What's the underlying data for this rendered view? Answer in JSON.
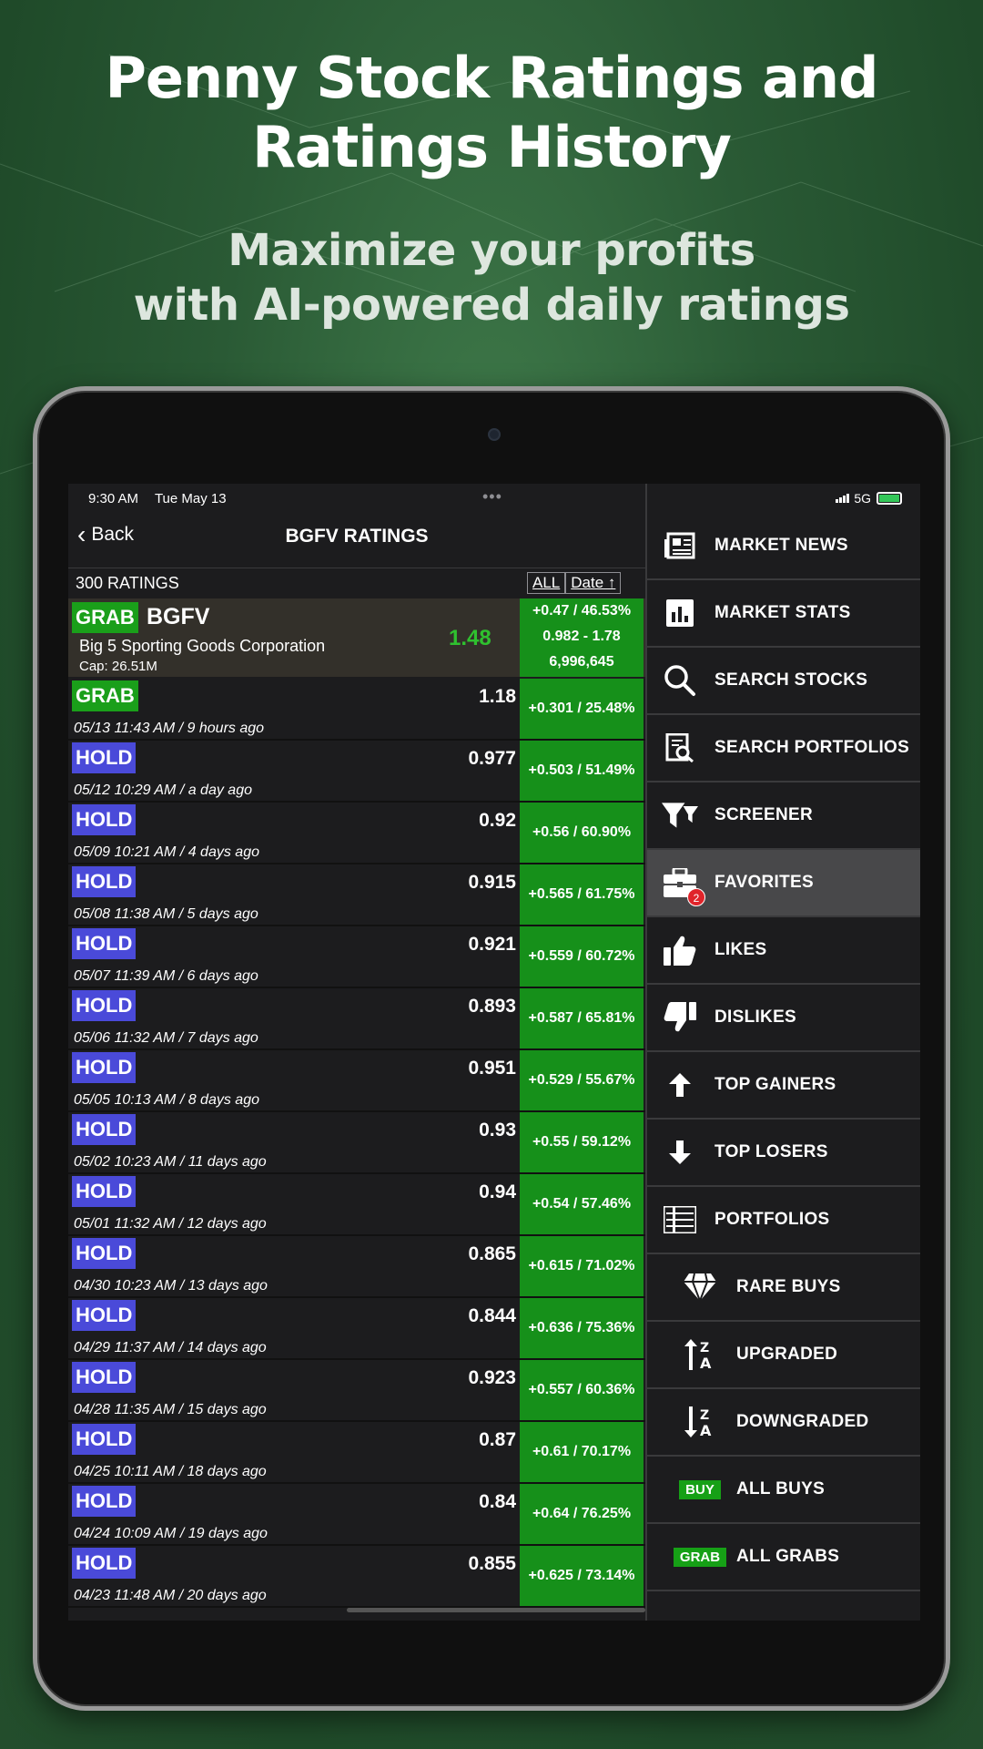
{
  "promo": {
    "headline_line1": "Penny Stock Ratings and",
    "headline_line2": "Ratings History",
    "subhead_line1": "Maximize your profits",
    "subhead_line2": "with AI-powered daily ratings"
  },
  "status": {
    "time": "9:30 AM",
    "date": "Tue May 13",
    "network": "5G"
  },
  "nav": {
    "back_label": "Back",
    "title": "BGFV RATINGS"
  },
  "list_header": {
    "count": "300 RATINGS",
    "filter_all": "ALL",
    "sort_label": "Date ↑"
  },
  "stock": {
    "rating": "GRAB",
    "ticker": "BGFV",
    "name": "Big 5 Sporting Goods Corporation",
    "cap": "Cap: 26.51M",
    "price": "1.48",
    "change": "+0.47 / 46.53%",
    "range": "0.982 - 1.78",
    "volume": "6,996,645"
  },
  "ratings": [
    {
      "rating": "GRAB",
      "price": "1.18",
      "date": "05/13 11:43 AM / 9 hours ago",
      "change": "+0.301 / 25.48%"
    },
    {
      "rating": "HOLD",
      "price": "0.977",
      "date": "05/12 10:29 AM / a day ago",
      "change": "+0.503 / 51.49%"
    },
    {
      "rating": "HOLD",
      "price": "0.92",
      "date": "05/09 10:21 AM / 4 days ago",
      "change": "+0.56 / 60.90%"
    },
    {
      "rating": "HOLD",
      "price": "0.915",
      "date": "05/08 11:38 AM / 5 days ago",
      "change": "+0.565 / 61.75%"
    },
    {
      "rating": "HOLD",
      "price": "0.921",
      "date": "05/07 11:39 AM / 6 days ago",
      "change": "+0.559 / 60.72%"
    },
    {
      "rating": "HOLD",
      "price": "0.893",
      "date": "05/06 11:32 AM / 7 days ago",
      "change": "+0.587 / 65.81%"
    },
    {
      "rating": "HOLD",
      "price": "0.951",
      "date": "05/05 10:13 AM / 8 days ago",
      "change": "+0.529 / 55.67%"
    },
    {
      "rating": "HOLD",
      "price": "0.93",
      "date": "05/02 10:23 AM / 11 days ago",
      "change": "+0.55 / 59.12%"
    },
    {
      "rating": "HOLD",
      "price": "0.94",
      "date": "05/01 11:32 AM / 12 days ago",
      "change": "+0.54 / 57.46%"
    },
    {
      "rating": "HOLD",
      "price": "0.865",
      "date": "04/30 10:23 AM / 13 days ago",
      "change": "+0.615 / 71.02%"
    },
    {
      "rating": "HOLD",
      "price": "0.844",
      "date": "04/29 11:37 AM / 14 days ago",
      "change": "+0.636 / 75.36%"
    },
    {
      "rating": "HOLD",
      "price": "0.923",
      "date": "04/28 11:35 AM / 15 days ago",
      "change": "+0.557 / 60.36%"
    },
    {
      "rating": "HOLD",
      "price": "0.87",
      "date": "04/25 10:11 AM / 18 days ago",
      "change": "+0.61 / 70.17%"
    },
    {
      "rating": "HOLD",
      "price": "0.84",
      "date": "04/24 10:09 AM / 19 days ago",
      "change": "+0.64 / 76.25%"
    },
    {
      "rating": "HOLD",
      "price": "0.855",
      "date": "04/23 11:48 AM / 20 days ago",
      "change": "+0.625 / 73.14%"
    }
  ],
  "menu": [
    {
      "label": "MARKET NEWS",
      "icon": "newspaper-icon"
    },
    {
      "label": "MARKET STATS",
      "icon": "bar-chart-icon"
    },
    {
      "label": "SEARCH STOCKS",
      "icon": "search-icon"
    },
    {
      "label": "SEARCH PORTFOLIOS",
      "icon": "search-document-icon"
    },
    {
      "label": "SCREENER",
      "icon": "filter-icon"
    },
    {
      "label": "FAVORITES",
      "icon": "briefcase-icon",
      "active": true,
      "notification": "2"
    },
    {
      "label": "LIKES",
      "icon": "thumbs-up-icon"
    },
    {
      "label": "DISLIKES",
      "icon": "thumbs-down-icon"
    },
    {
      "label": "TOP GAINERS",
      "icon": "arrow-up-icon"
    },
    {
      "label": "TOP LOSERS",
      "icon": "arrow-down-icon"
    },
    {
      "label": "PORTFOLIOS",
      "icon": "list-icon"
    },
    {
      "label": "RARE BUYS",
      "icon": "diamond-icon",
      "sub": true
    },
    {
      "label": "UPGRADED",
      "icon": "sort-up-icon",
      "sub": true
    },
    {
      "label": "DOWNGRADED",
      "icon": "sort-down-icon",
      "sub": true
    },
    {
      "label": "ALL BUYS",
      "icon": "buy-badge",
      "badge": "BUY",
      "sub": true
    },
    {
      "label": "ALL GRABS",
      "icon": "grab-badge",
      "badge": "GRAB",
      "sub": true
    }
  ],
  "colors": {
    "grab": "#1a9f1a",
    "hold": "#4a4ad9",
    "change_bg": "#16901a",
    "price_up": "#2fc12f"
  }
}
